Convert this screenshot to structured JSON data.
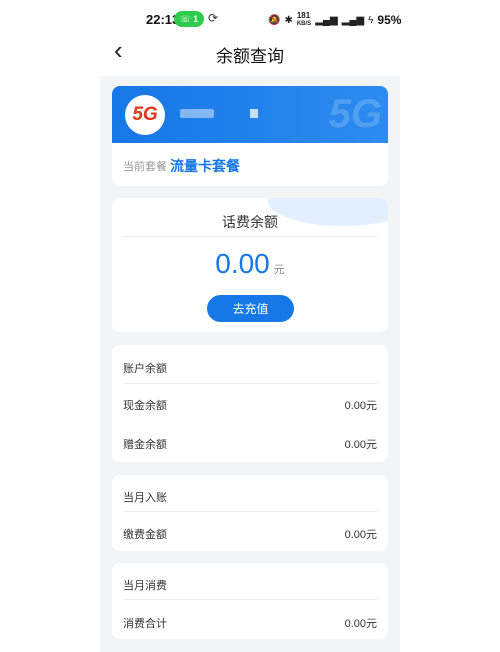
{
  "status_bar": {
    "time": "22:13",
    "pill_count": "1",
    "speed": "181",
    "speed_unit": "KB/S",
    "signal": "⁵ᴳ",
    "battery": "95%"
  },
  "header": {
    "title": "余额查询"
  },
  "account": {
    "logo_text": "5G",
    "package_label": "当前套餐",
    "package_name": "流量卡套餐"
  },
  "balance": {
    "title": "话费余额",
    "amount": "0.00",
    "unit": "元",
    "recharge_label": "去充值"
  },
  "account_balance": {
    "title": "账户余额",
    "rows": [
      {
        "label": "现金余额",
        "value": "0.00元"
      },
      {
        "label": "赠金余额",
        "value": "0.00元"
      }
    ]
  },
  "month_income": {
    "title": "当月入账",
    "rows": [
      {
        "label": "缴费金额",
        "value": "0.00元"
      }
    ]
  },
  "month_spend": {
    "title": "当月消费",
    "rows": [
      {
        "label": "消费合计",
        "value": "0.00元"
      }
    ]
  },
  "colors": {
    "accent": "#1677e6",
    "background": "#f3f4f6"
  }
}
